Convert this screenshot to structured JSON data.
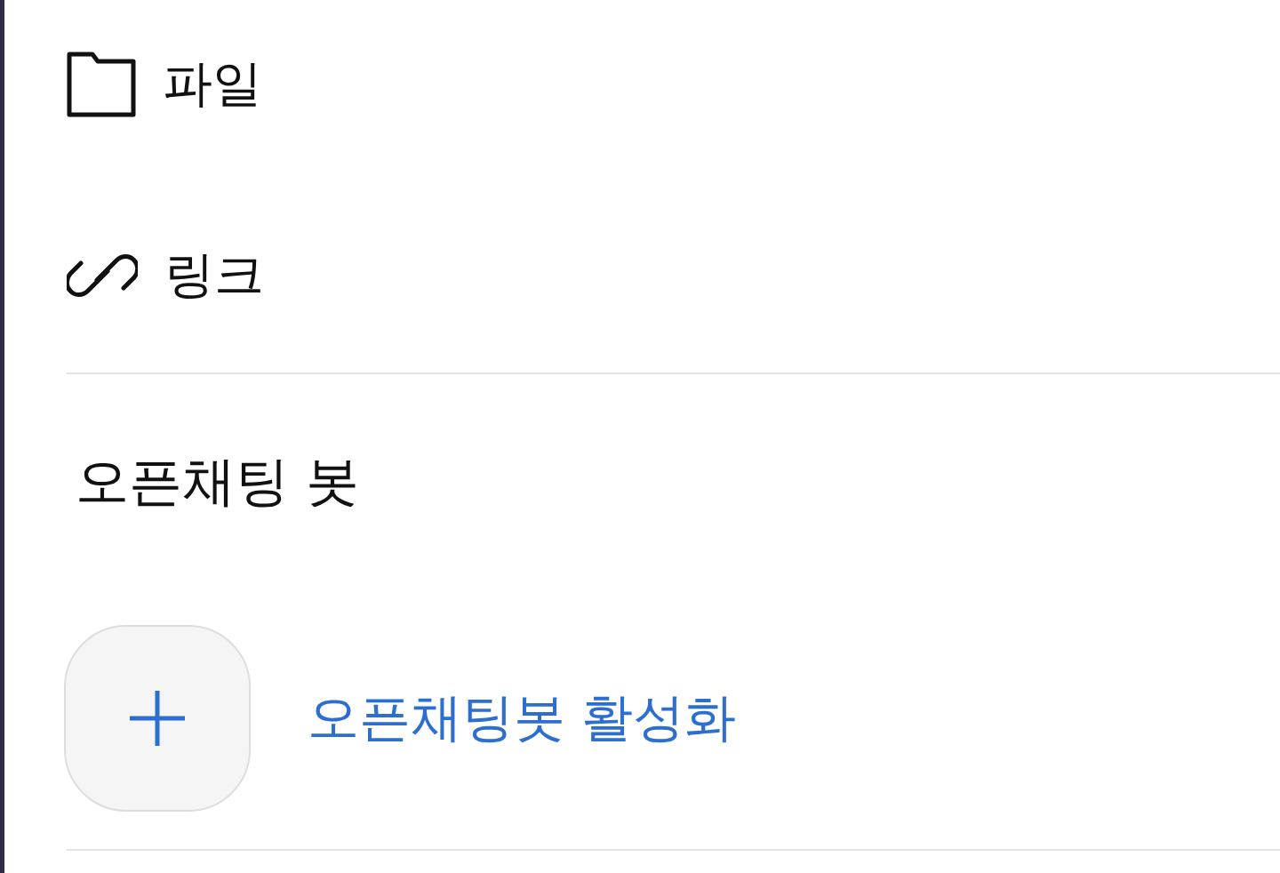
{
  "menu_items": [
    {
      "kind": "file",
      "label": "파일"
    },
    {
      "kind": "link",
      "label": "링크"
    }
  ],
  "section": {
    "title": "오픈채팅 봇",
    "action": {
      "kind": "add",
      "label": "오픈채팅봇 활성화"
    }
  }
}
